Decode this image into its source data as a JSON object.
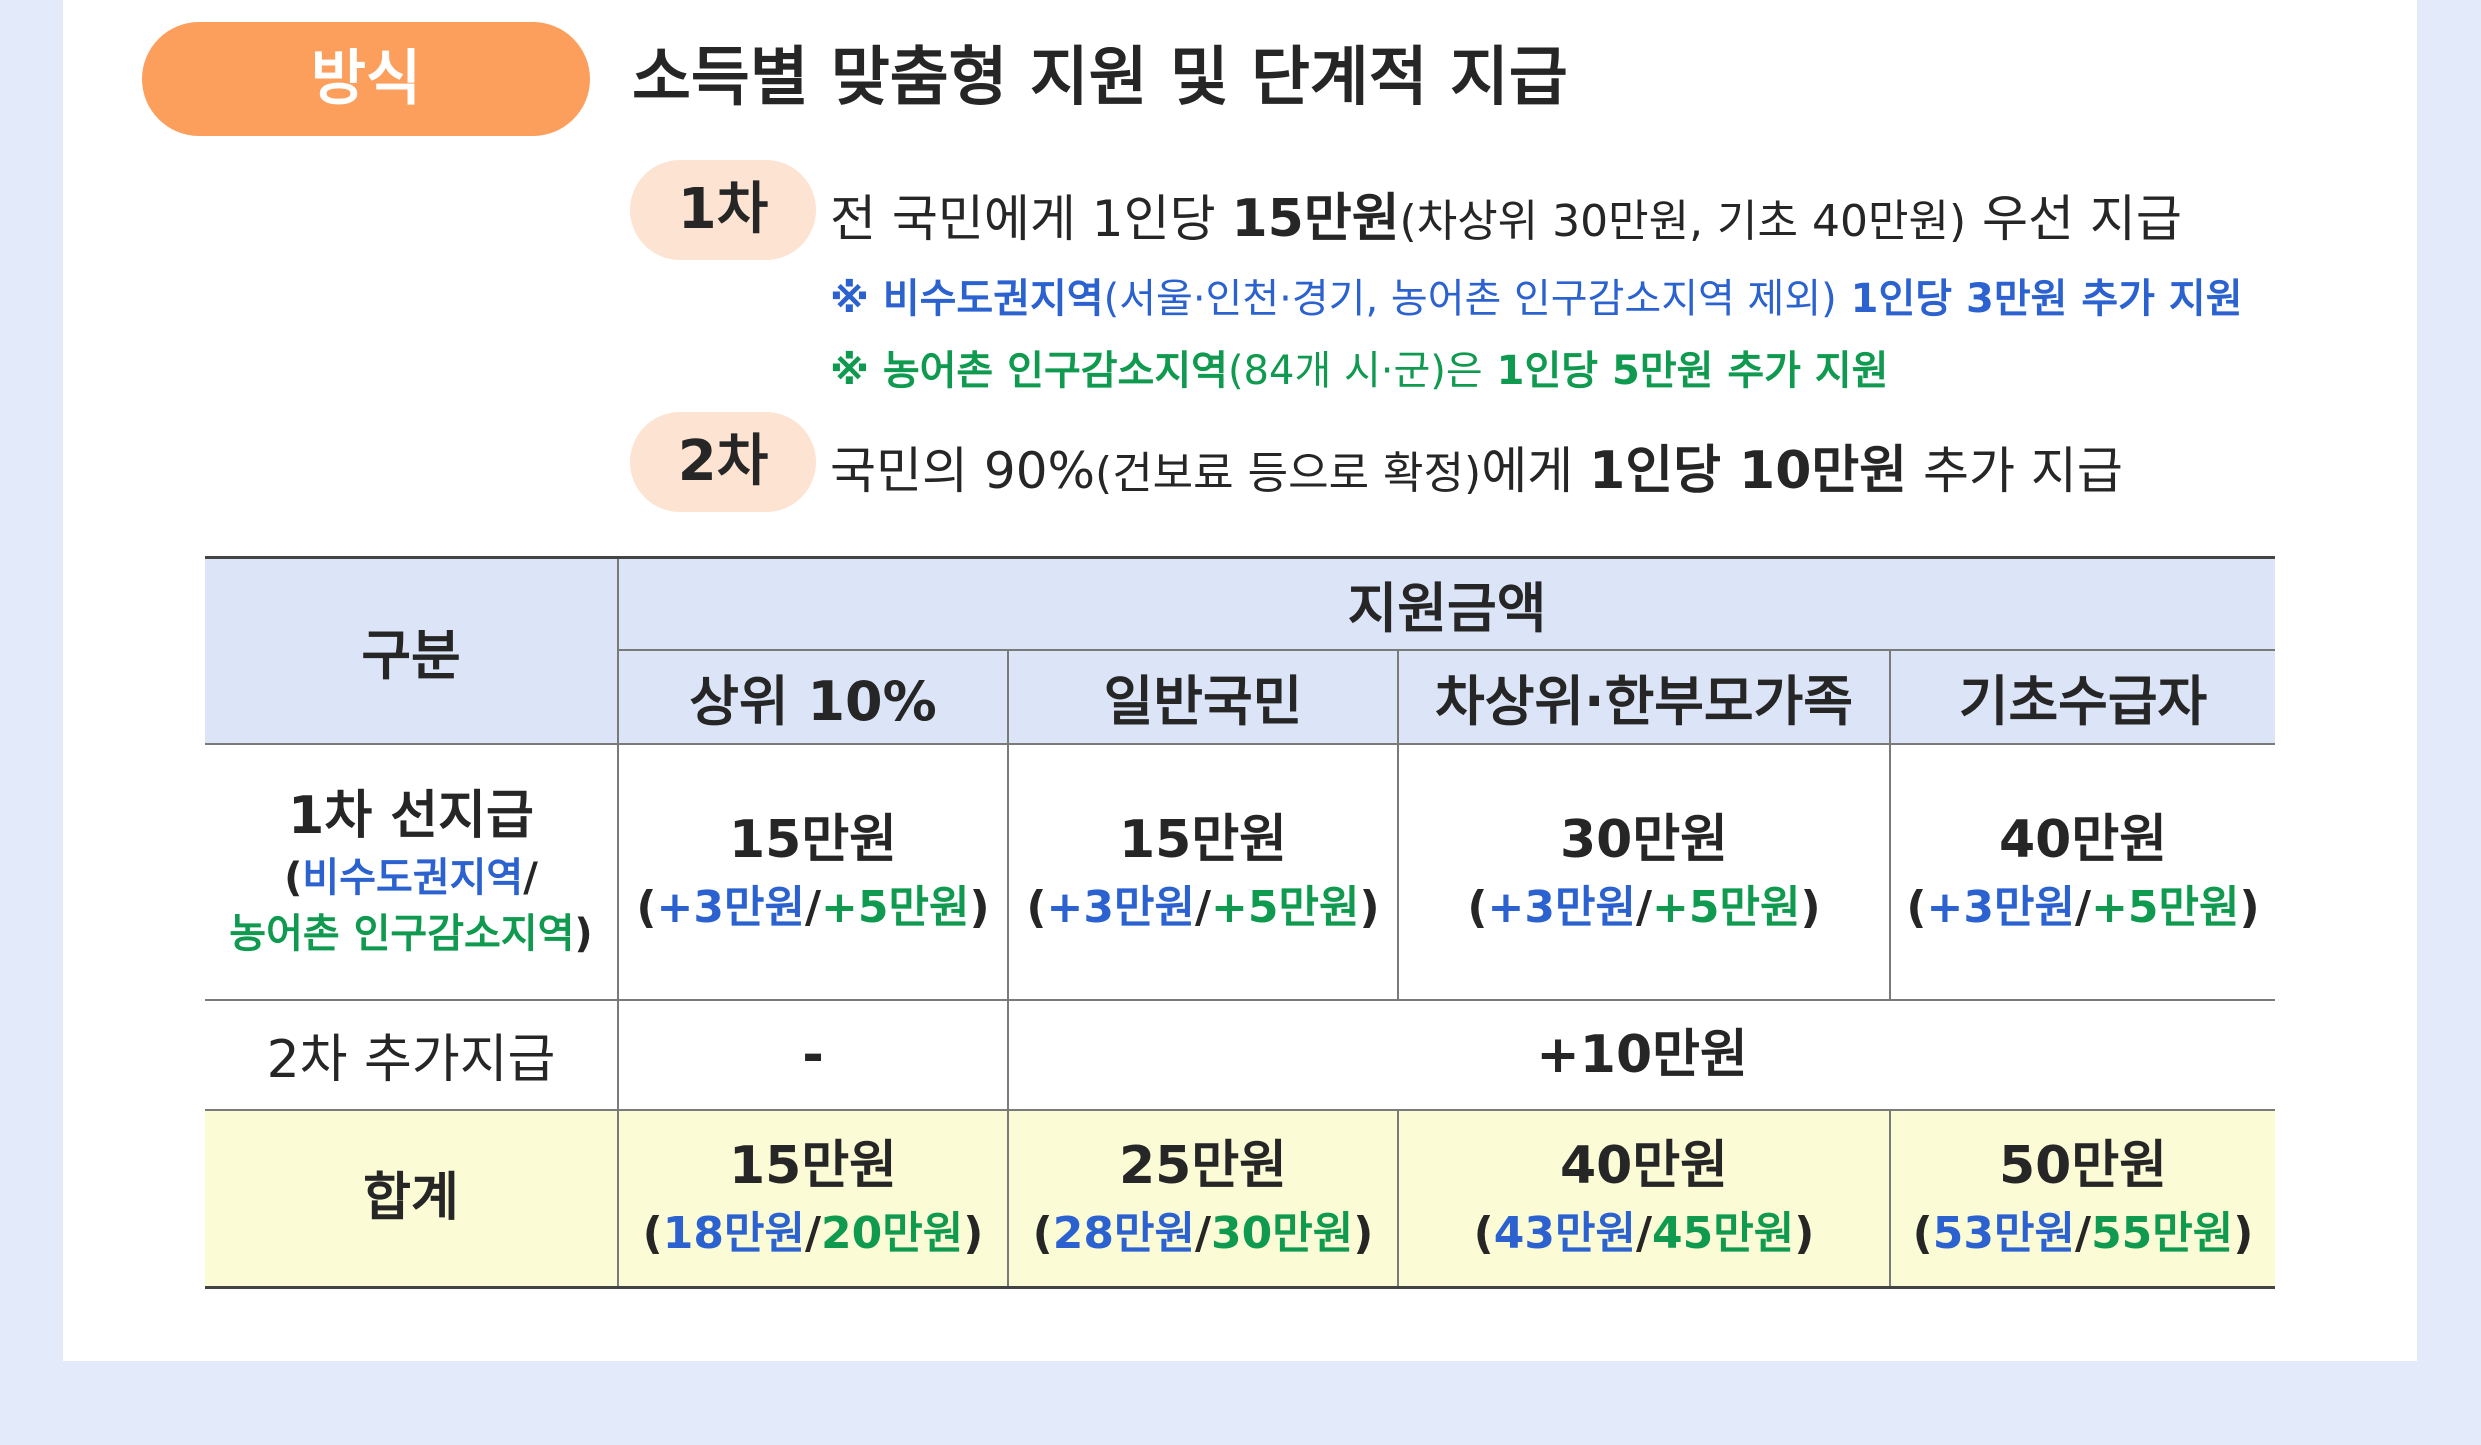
{
  "method": {
    "label": "방식",
    "title": "소득별 맞춤형 지원 및 단계적 지급"
  },
  "steps": [
    {
      "badge": "1차",
      "text_pre": "전 국민에게 1인당 ",
      "text_bold": "15만원",
      "text_paren": "(차상위 30만원, 기초 40만원)",
      "text_post": " 우선 지급",
      "notes": [
        {
          "mark": "※ ",
          "highlight": "비수도권지역",
          "paren": "(서울·인천·경기, 농어촌 인구감소지역 제외)",
          "tail": " 1인당 3만원 추가 지원",
          "color": "#2b62cf"
        },
        {
          "mark": "※ ",
          "highlight": "농어촌 인구감소지역",
          "paren": "(84개 시·군)은",
          "tail": " 1인당 5만원 추가 지원",
          "color": "#0f9a4f"
        }
      ]
    },
    {
      "badge": "2차",
      "text_pre": "국민의 90%",
      "text_paren": "(건보료 등으로 확정)",
      "text_mid": "에게 ",
      "text_bold": "1인당 10만원",
      "text_post": " 추가 지급"
    }
  ],
  "table": {
    "header": {
      "category": "구분",
      "group": "지원금액",
      "columns": [
        "상위 10%",
        "일반국민",
        "차상위·한부모가족",
        "기초수급자"
      ]
    },
    "row1": {
      "label_main": "1차 선지급",
      "label_paren_open": "(",
      "label_blue": "비수도권지역",
      "label_slash": "/",
      "label_green": "농어촌 인구감소지역",
      "label_paren_close": ")",
      "cells": [
        {
          "main": "15만원",
          "blue": "+3만원",
          "green": "+5만원"
        },
        {
          "main": "15만원",
          "blue": "+3만원",
          "green": "+5만원"
        },
        {
          "main": "30만원",
          "blue": "+3만원",
          "green": "+5만원"
        },
        {
          "main": "40만원",
          "blue": "+3만원",
          "green": "+5만원"
        }
      ]
    },
    "row2": {
      "label": "2차 추가지급",
      "first": "-",
      "rest": "+10만원"
    },
    "total": {
      "label": "합계",
      "cells": [
        {
          "main": "15만원",
          "blue": "18만원",
          "green": "20만원"
        },
        {
          "main": "25만원",
          "blue": "28만원",
          "green": "30만원"
        },
        {
          "main": "40만원",
          "blue": "43만원",
          "green": "45만원"
        },
        {
          "main": "50만원",
          "blue": "53만원",
          "green": "55만원"
        }
      ]
    },
    "punct": {
      "open": "(",
      "slash": "/",
      "close": ")"
    }
  },
  "colors": {
    "accent_orange": "#fc9e5c",
    "badge_bg": "#fde3d2",
    "header_bg": "#dce5f8",
    "total_bg": "#fbfbd6",
    "blue": "#2b62cf",
    "green": "#0f9a4f",
    "page_bg": "#e3ebfb"
  }
}
